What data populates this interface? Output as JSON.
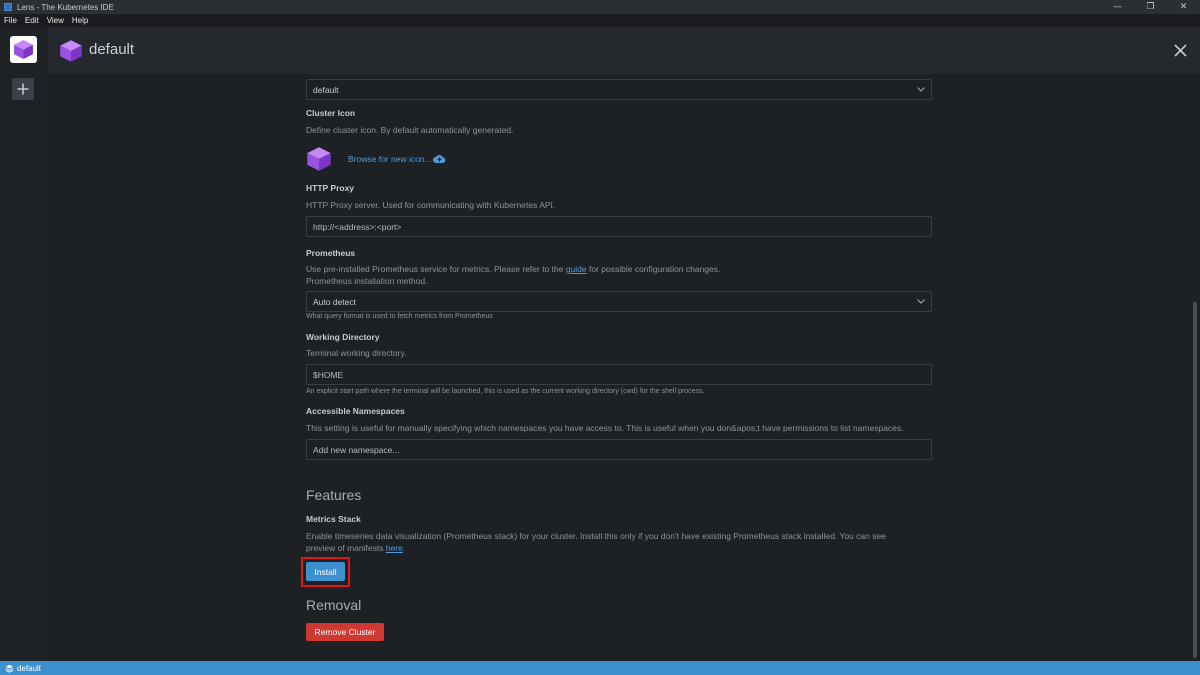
{
  "window": {
    "title": "Lens - The Kubernetes IDE"
  },
  "menu": [
    "File",
    "Edit",
    "View",
    "Help"
  ],
  "header": {
    "cluster_name": "default"
  },
  "settings": {
    "workspace_value": "default",
    "cluster_icon": {
      "label": "Cluster Icon",
      "desc": "Define cluster icon. By default automatically generated.",
      "browse_label": "Browse for new icon..."
    },
    "http_proxy": {
      "label": "HTTP Proxy",
      "desc": "HTTP Proxy server. Used for communicating with Kubernetes API.",
      "placeholder": "http://<address>:<port>"
    },
    "prometheus": {
      "label": "Prometheus",
      "desc_prefix": "Use pre-installed Prometheus service for metrics. Please refer to the ",
      "desc_link": "guide",
      "desc_suffix": " for possible configuration changes.",
      "desc2": "Prometheus installation method.",
      "select_value": "Auto detect",
      "hint": "What query format is used to fetch metrics from Prometheus"
    },
    "working_directory": {
      "label": "Working Directory",
      "desc": "Terminal working directory.",
      "placeholder": "$HOME",
      "hint": "An explicit start path where the terminal will be launched, this is used as the current working directory (cwd) for the shell process."
    },
    "accessible_namespaces": {
      "label": "Accessible Namespaces",
      "desc": "This setting is useful for manually specifying which namespaces you have access to. This is useful when you don&apos;t have permissions to list namespaces.",
      "placeholder": "Add new namespace..."
    }
  },
  "features": {
    "title": "Features",
    "metrics_stack": {
      "label": "Metrics Stack",
      "desc1": "Enable timeseries data visualization (Prometheus stack) for your cluster. Install this only if you don't have existing Prometheus stack installed. You can see",
      "desc2_prefix": "preview of manifests ",
      "desc2_link": "here",
      "desc2_suffix": ".",
      "install_label": "Install"
    }
  },
  "removal": {
    "title": "Removal",
    "remove_label": "Remove Cluster"
  },
  "statusbar": {
    "cluster": "default"
  },
  "colors": {
    "accent": "#3d90ce",
    "danger": "#ce3933",
    "highlight": "#e0161d",
    "cube": "#a35ee8"
  }
}
